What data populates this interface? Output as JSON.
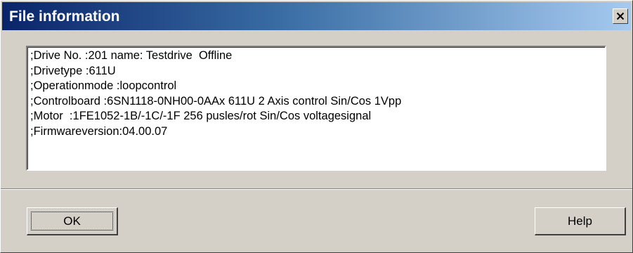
{
  "window": {
    "title": "File information",
    "close_icon": "close-icon"
  },
  "info": {
    "lines": [
      ";Drive No. :201 name: Testdrive  Offline",
      ";Drivetype :611U",
      ";Operationmode :loopcontrol",
      ";Controlboard :6SN1118-0NH00-0AAx 611U 2 Axis control Sin/Cos 1Vpp",
      ";Motor  :1FE1052-1B/-1C/-1F 256 pusles/rot Sin/Cos voltagesignal",
      ";Firmwareversion:04.00.07"
    ]
  },
  "buttons": {
    "ok_label": "OK",
    "help_label": "Help"
  },
  "colors": {
    "title_gradient_start": "#0a246a",
    "title_gradient_end": "#a6caf0",
    "dialog_face": "#d4d0c8"
  }
}
